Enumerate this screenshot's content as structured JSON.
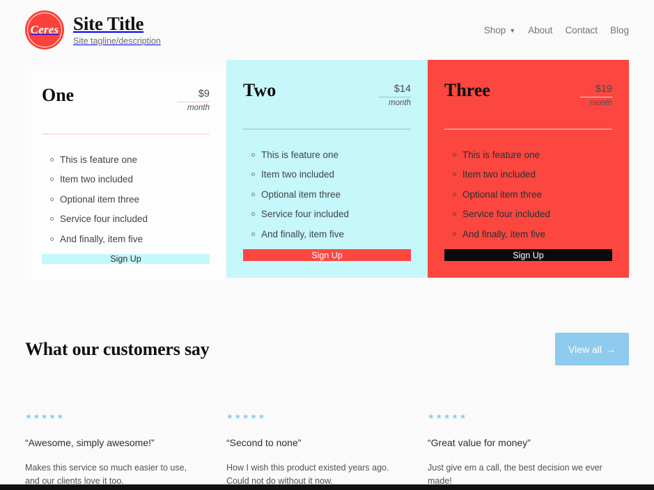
{
  "header": {
    "logo_text": "Ceres",
    "site_title": "Site Title",
    "site_tagline": "Site tagline/description",
    "nav": [
      {
        "label": "Shop",
        "has_caret": true,
        "caret": "⌄"
      },
      {
        "label": "About",
        "has_caret": false
      },
      {
        "label": "Contact",
        "has_caret": false
      },
      {
        "label": "Blog",
        "has_caret": false
      }
    ]
  },
  "pricing": {
    "plans": [
      {
        "name": "One",
        "price": "$9",
        "period": "month",
        "features": [
          "This is feature one",
          "Item two included",
          "Optional item three",
          "Service four included",
          "And finally, item five"
        ],
        "cta_label": "Sign Up",
        "background": "#fefdfd",
        "cta_background": "#c6f7fb"
      },
      {
        "name": "Two",
        "price": "$14",
        "period": "month",
        "features": [
          "This is feature one",
          "Item two included",
          "Optional item three",
          "Service four included",
          "And finally, item five"
        ],
        "cta_label": "Sign Up",
        "background": "#c6f7fb",
        "cta_background": "#fb4740"
      },
      {
        "name": "Three",
        "price": "$19",
        "period": "month",
        "features": [
          "This is feature one",
          "Item two included",
          "Optional item three",
          "Service four included",
          "And finally, item five"
        ],
        "cta_label": "Sign Up",
        "background": "#fb4740",
        "cta_background": "#0b0b0b"
      }
    ]
  },
  "testimonials": {
    "title": "What our customers say",
    "view_all_label": "View all",
    "view_all_arrow": "→",
    "rating_stars": "★★★★★",
    "items": [
      {
        "stars": "★★★★★",
        "quote": "“Awesome, simply awesome!”",
        "body": "Makes this service so much easier to use, and our clients love it too."
      },
      {
        "stars": "★★★★★",
        "quote": "“Second to none”",
        "body": "How I wish this product existed years ago. Could not do without it now."
      },
      {
        "stars": "★★★★★",
        "quote": "“Great value for money”",
        "body": "Just give em a call, the best decision we ever made!"
      }
    ]
  },
  "colors": {
    "brand_red": "#fb4740",
    "brand_cyan": "#c6f7fb",
    "accent_blue": "#8fcbee",
    "page_background": "#fafafa",
    "footer": "#111111"
  }
}
